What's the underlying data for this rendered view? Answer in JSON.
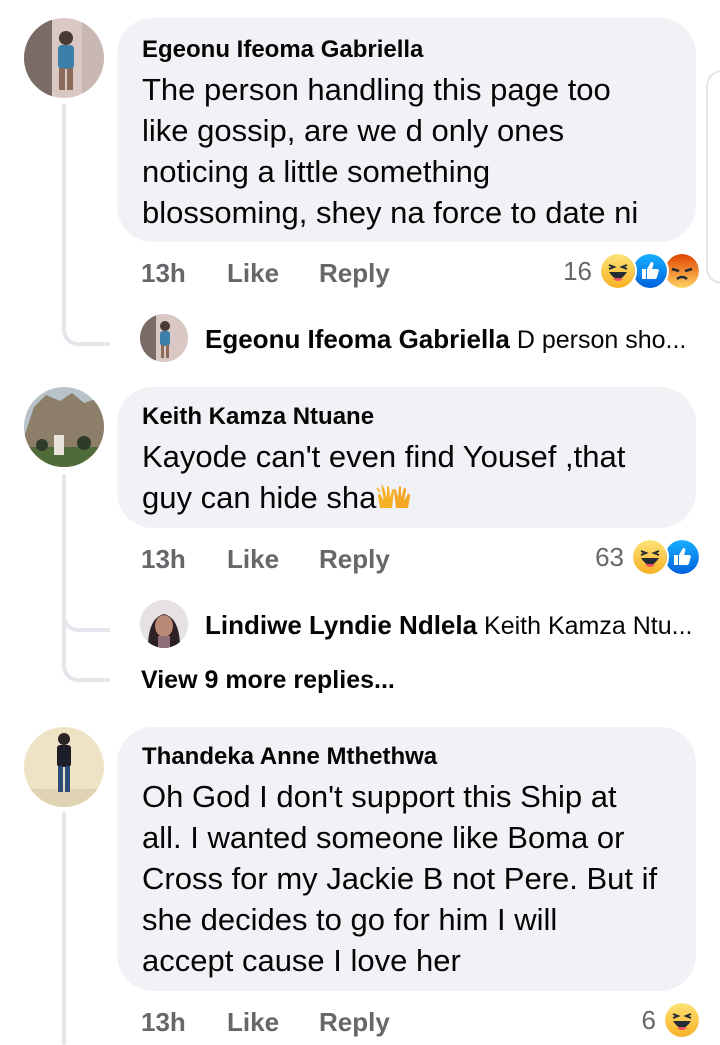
{
  "comments": [
    {
      "author": "Egeonu Ifeoma Gabriella",
      "text_lines": [
        "The person handling this page too",
        "like gossip, are we d only ones",
        "noticing a little something",
        "blossoming, shey na force to date ni"
      ],
      "time": "13h",
      "like_label": "Like",
      "reply_label": "Reply",
      "reaction_count": "16",
      "reactions": [
        "haha",
        "like",
        "angry"
      ],
      "reply_preview": {
        "author": "Egeonu Ifeoma Gabriella",
        "snippet": "D person sho..."
      }
    },
    {
      "author": "Keith Kamza Ntuane",
      "text_lines": [
        "Kayode can't even find Yousef ,that",
        "guy can hide sha"
      ],
      "trailing_emoji": "raising-hands",
      "time": "13h",
      "like_label": "Like",
      "reply_label": "Reply",
      "reaction_count": "63",
      "reactions": [
        "haha",
        "like"
      ],
      "reply_preview": {
        "author": "Lindiwe Lyndie Ndlela",
        "snippet": "Keith Kamza Ntu..."
      },
      "view_more": "View 9 more replies..."
    },
    {
      "author": "Thandeka Anne Mthethwa",
      "text_lines": [
        "Oh God I don't support this Ship at",
        "all. I wanted someone like Boma or",
        "Cross for my Jackie B not Pere. But if",
        "she decides to go for him I will",
        "accept cause I love her"
      ],
      "time": "13h",
      "like_label": "Like",
      "reply_label": "Reply",
      "reaction_count": "6",
      "reactions": [
        "haha"
      ]
    }
  ],
  "colors": {
    "bubble": "#f0f2f5",
    "meta": "#65676b",
    "like_blue": "#1877f2",
    "haha_yellow": "#f7b125",
    "angry_orange": "#e9710f"
  }
}
